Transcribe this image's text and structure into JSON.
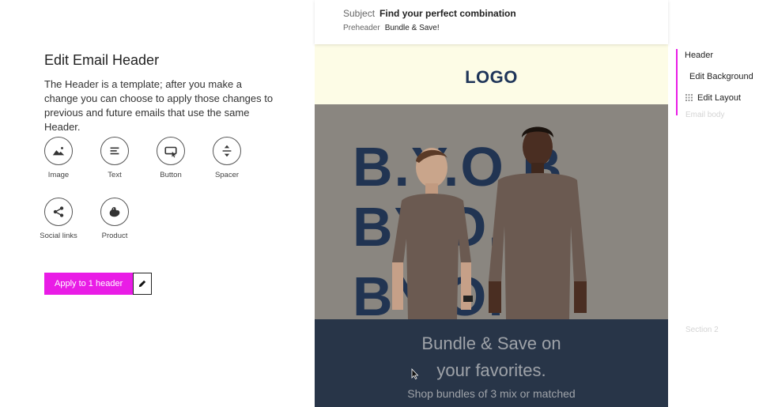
{
  "editor": {
    "title": "Edit Email Header",
    "description": "The Header is a template; after you make a change you can choose to apply those changes to previous and future emails that use the same Header.",
    "tools": [
      {
        "label": "Image",
        "icon": "image-icon"
      },
      {
        "label": "Text",
        "icon": "text-icon"
      },
      {
        "label": "Button",
        "icon": "button-icon"
      },
      {
        "label": "Spacer",
        "icon": "spacer-icon"
      },
      {
        "label": "Social links",
        "icon": "share-icon"
      },
      {
        "label": "Product",
        "icon": "product-icon"
      }
    ],
    "apply_label": "Apply to 1 header",
    "accent": "#e91ce6"
  },
  "email": {
    "subject_key": "Subject",
    "subject_value": "Find your perfect combination",
    "preheader_key": "Preheader",
    "preheader_value": "Bundle & Save!",
    "logo": "LOGO",
    "header_bg": "#fdfce6",
    "hero_rows": [
      "B.Y.O.B",
      "BY.O.B",
      "BY.O.B"
    ],
    "headline": "Bundle & Save on your favorites.",
    "subtext": "Shop bundles of 3 mix or matched",
    "dark_bg": "#283548"
  },
  "navigator": {
    "header": "Header",
    "edit_background": "Edit Background",
    "edit_layout": "Edit Layout",
    "email_body": "Email body",
    "section_2": "Section 2"
  }
}
